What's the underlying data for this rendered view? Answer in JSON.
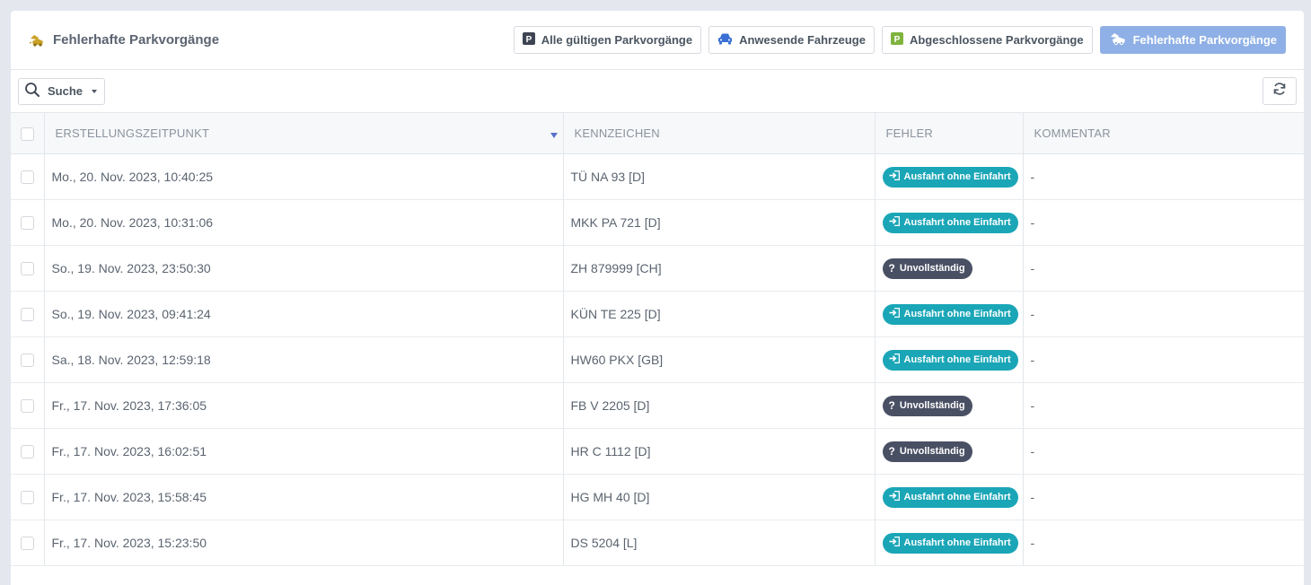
{
  "header": {
    "title": "Fehlerhafte Parkvorgänge",
    "nav": [
      {
        "label": "Alle gültigen Parkvorgänge"
      },
      {
        "label": "Anwesende Fahrzeuge"
      },
      {
        "label": "Abgeschlossene Parkvorgänge"
      },
      {
        "label": "Fehlerhafte Parkvorgänge"
      }
    ]
  },
  "toolbar": {
    "search_label": "Suche"
  },
  "table": {
    "columns": [
      "ERSTELLUNGSZEITPUNKT",
      "KENNZEICHEN",
      "FEHLER",
      "KOMMENTAR"
    ],
    "rows": [
      {
        "time": "Mo., 20. Nov. 2023, 10:40:25",
        "plate": "TÜ NA 93 [D]",
        "error": "Ausfahrt ohne Einfahrt",
        "comment": "-"
      },
      {
        "time": "Mo., 20. Nov. 2023, 10:31:06",
        "plate": "MKK PA 721 [D]",
        "error": "Ausfahrt ohne Einfahrt",
        "comment": "-"
      },
      {
        "time": "So., 19. Nov. 2023, 23:50:30",
        "plate": "ZH 879999 [CH]",
        "error": "Unvollständig",
        "comment": "-"
      },
      {
        "time": "So., 19. Nov. 2023, 09:41:24",
        "plate": "KÜN TE 225 [D]",
        "error": "Ausfahrt ohne Einfahrt",
        "comment": "-"
      },
      {
        "time": "Sa., 18. Nov. 2023, 12:59:18",
        "plate": "HW60 PKX [GB]",
        "error": "Ausfahrt ohne Einfahrt",
        "comment": "-"
      },
      {
        "time": "Fr., 17. Nov. 2023, 17:36:05",
        "plate": "FB V 2205 [D]",
        "error": "Unvollständig",
        "comment": "-"
      },
      {
        "time": "Fr., 17. Nov. 2023, 16:02:51",
        "plate": "HR C 1112 [D]",
        "error": "Unvollständig",
        "comment": "-"
      },
      {
        "time": "Fr., 17. Nov. 2023, 15:58:45",
        "plate": "HG MH 40 [D]",
        "error": "Ausfahrt ohne Einfahrt",
        "comment": "-"
      },
      {
        "time": "Fr., 17. Nov. 2023, 15:23:50",
        "plate": "DS 5204 [L]",
        "error": "Ausfahrt ohne Einfahrt",
        "comment": "-"
      }
    ]
  },
  "colors": {
    "exit_badge": "#1aa6b7",
    "incomplete_badge": "#4a5064",
    "active_nav": "#8fb0e6"
  }
}
